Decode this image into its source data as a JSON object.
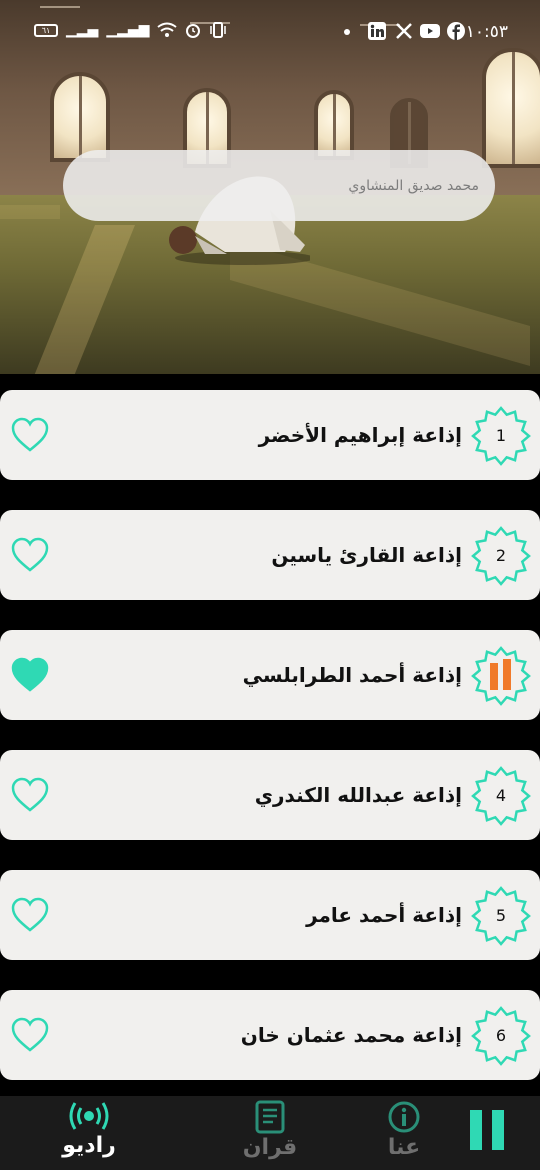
{
  "status_bar": {
    "time": "١٠:٥٣",
    "battery": "٦١"
  },
  "search": {
    "placeholder": "محمد صديق المنشاوي"
  },
  "colors": {
    "accent": "#2fd9b4",
    "card_bg": "#f1f0ee",
    "nav_bg": "#1b1b1b",
    "playing_orange": "#f07a2a"
  },
  "stations": [
    {
      "number": "1",
      "name": "إذاعة إبراهيم الأخضر",
      "favorite": false,
      "playing": false
    },
    {
      "number": "2",
      "name": "إذاعة القارئ ياسين",
      "favorite": false,
      "playing": false
    },
    {
      "number": "",
      "name": "إذاعة أحمد الطرابلسي",
      "favorite": true,
      "playing": true
    },
    {
      "number": "4",
      "name": "إذاعة عبدالله الكندري",
      "favorite": false,
      "playing": false
    },
    {
      "number": "5",
      "name": "إذاعة أحمد عامر",
      "favorite": false,
      "playing": false
    },
    {
      "number": "6",
      "name": "إذاعة محمد عثمان خان",
      "favorite": false,
      "playing": false
    }
  ],
  "nav": {
    "radio": "راديو",
    "quran": "قران",
    "about": "عنا",
    "radio_icon": "radio-broadcast-icon",
    "quran_icon": "book-icon",
    "about_icon": "info-icon",
    "player_icon": "pause-icon"
  }
}
